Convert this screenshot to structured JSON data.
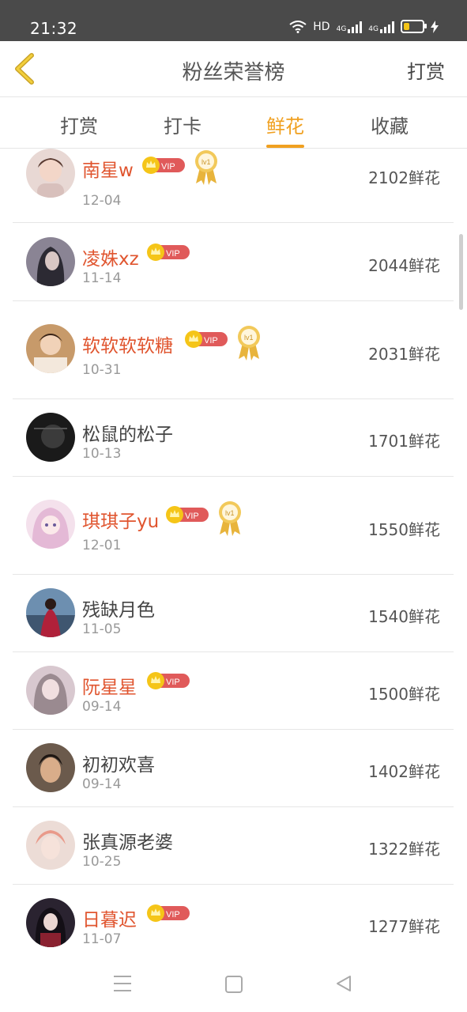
{
  "status_bar": {
    "time": "21:32",
    "network_label": "HD",
    "signal_1": "4G",
    "signal_2": "4G"
  },
  "header": {
    "title": "粉丝荣誉榜",
    "action": "打赏"
  },
  "tabs": [
    {
      "label": "打赏",
      "active": false
    },
    {
      "label": "打卡",
      "active": false
    },
    {
      "label": "鲜花",
      "active": true
    },
    {
      "label": "收藏",
      "active": false
    }
  ],
  "colors": {
    "accent": "#f0a020",
    "vip_name": "#e0552f",
    "vip_badge": "#e05a5a"
  },
  "vip_label": "VIP",
  "medal_label": "lv1",
  "rows": [
    {
      "name": "南星w",
      "date": "12-04",
      "count": "2102鲜花",
      "vip": true,
      "medal": true
    },
    {
      "name": "凌姝xz",
      "date": "11-14",
      "count": "2044鲜花",
      "vip": true,
      "medal": false
    },
    {
      "name": "软软软软糖",
      "date": "10-31",
      "count": "2031鲜花",
      "vip": true,
      "medal": true
    },
    {
      "name": "松鼠的松子",
      "date": "10-13",
      "count": "1701鲜花",
      "vip": false,
      "medal": false
    },
    {
      "name": "琪琪子yu",
      "date": "12-01",
      "count": "1550鲜花",
      "vip": true,
      "medal": true
    },
    {
      "name": "残缺月色",
      "date": "11-05",
      "count": "1540鲜花",
      "vip": false,
      "medal": false
    },
    {
      "name": "阮星星",
      "date": "09-14",
      "count": "1500鲜花",
      "vip": true,
      "medal": false
    },
    {
      "name": "初初欢喜",
      "date": "09-14",
      "count": "1402鲜花",
      "vip": false,
      "medal": false
    },
    {
      "name": "张真源老婆",
      "date": "10-25",
      "count": "1322鲜花",
      "vip": false,
      "medal": false
    },
    {
      "name": "日暮迟",
      "date": "11-07",
      "count": "1277鲜花",
      "vip": true,
      "medal": false
    }
  ]
}
